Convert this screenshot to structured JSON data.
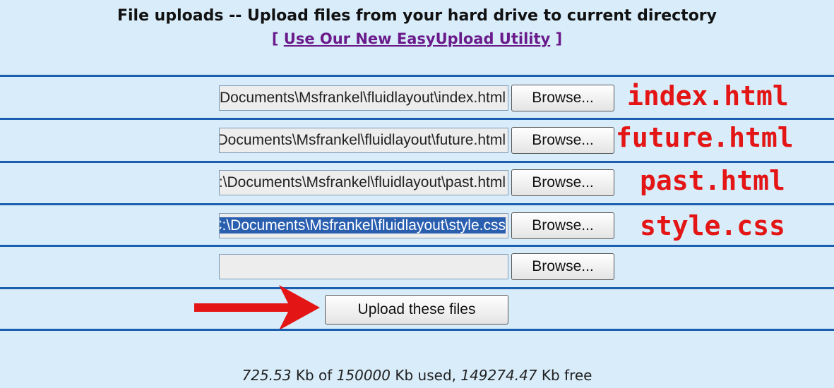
{
  "header": {
    "title": "File uploads -- Upload files from your hard drive to current directory",
    "link_label": "Use Our New EasyUpload Utility",
    "link_open": "[ ",
    "link_close": " ]"
  },
  "rows": [
    {
      "path": "C:\\Documents\\Msfrankel\\fluidlayout\\index.html",
      "browse_label": "Browse...",
      "annotation": "index.html",
      "selected": false
    },
    {
      "path": "C:\\Documents\\Msfrankel\\fluidlayout\\future.html",
      "browse_label": "Browse...",
      "annotation": "future.html",
      "selected": false
    },
    {
      "path": "C:\\Documents\\Msfrankel\\fluidlayout\\past.html",
      "browse_label": "Browse...",
      "annotation": "past.html",
      "selected": false
    },
    {
      "path": "C:\\Documents\\Msfrankel\\fluidlayout\\style.css",
      "browse_label": "Browse...",
      "annotation": "style.css",
      "selected": true
    },
    {
      "path": "",
      "browse_label": "Browse...",
      "annotation": "",
      "selected": false
    }
  ],
  "upload_button_label": "Upload these files",
  "footer": {
    "used": "725.53",
    "kb1": " Kb of ",
    "total": "150000",
    "kb2": " Kb used, ",
    "free": "149274.47",
    "kb3": " Kb free"
  },
  "colors": {
    "background": "#d8ecfa",
    "divider": "#1b5fb0",
    "annotation": "#e31515",
    "link": "#6a1a8a",
    "selection": "#2a5fb0"
  }
}
